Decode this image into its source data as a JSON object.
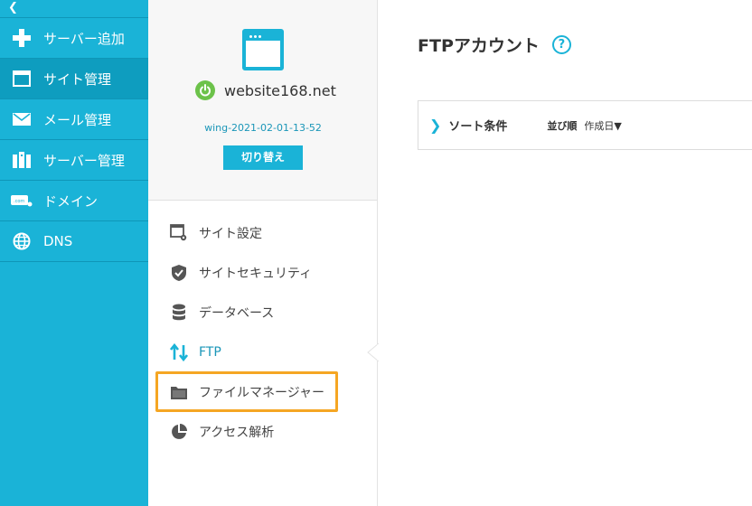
{
  "nav": {
    "collapse_glyph": "❮",
    "items": [
      {
        "label": "サーバー追加",
        "icon": "plus-icon"
      },
      {
        "label": "サイト管理",
        "icon": "window-icon"
      },
      {
        "label": "メール管理",
        "icon": "mail-icon"
      },
      {
        "label": "サーバー管理",
        "icon": "server-icon"
      },
      {
        "label": "ドメイン",
        "icon": "domain-icon"
      },
      {
        "label": "DNS",
        "icon": "globe-icon"
      }
    ],
    "active_index": 1
  },
  "site": {
    "name": "website168.net",
    "id": "wing-2021-02-01-13-52",
    "switch_label": "切り替え",
    "status_color": "#6cc24a"
  },
  "menu": {
    "items": [
      {
        "label": "サイト設定",
        "icon": "site-settings-icon"
      },
      {
        "label": "サイトセキュリティ",
        "icon": "shield-check-icon"
      },
      {
        "label": "データベース",
        "icon": "database-icon"
      },
      {
        "label": "FTP",
        "icon": "transfer-arrows-icon"
      },
      {
        "label": "ファイルマネージャー",
        "icon": "folder-icon"
      },
      {
        "label": "アクセス解析",
        "icon": "pie-chart-icon"
      }
    ],
    "current_index": 3,
    "highlight_index": 4
  },
  "main": {
    "title": "FTPアカウント",
    "help_glyph": "?",
    "sort": {
      "chevron": "❯",
      "title": "ソート条件",
      "key_label": "並び順",
      "value": "作成日▼"
    }
  },
  "colors": {
    "accent": "#1ab3d7",
    "nav_active": "#0e9dbf",
    "highlight": "#f5a623"
  }
}
